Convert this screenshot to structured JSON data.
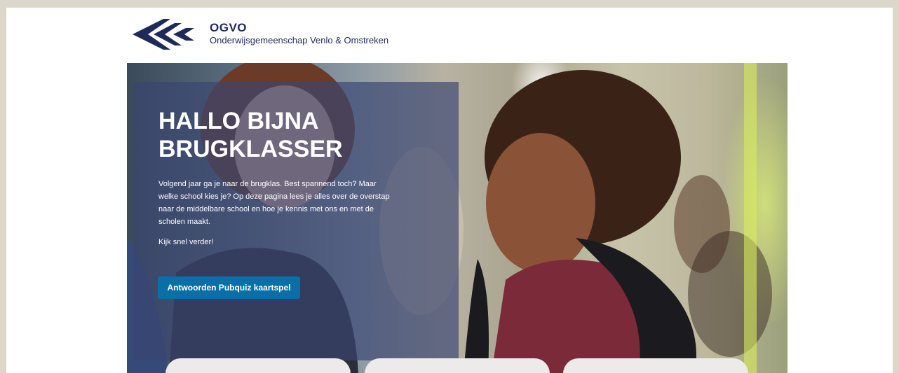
{
  "header": {
    "brand_name": "OGVO",
    "brand_subtitle": "Onderwijsgemeenschap Venlo & Omstreken",
    "logo_icon": "chevron-arrows-logo-icon"
  },
  "hero": {
    "title": "HALLO BIJNA BRUGKLASSER",
    "intro": "Volgend jaar ga je naar de brugklas. Best spannend toch? Maar welke school kies je? Op deze pagina lees je alles over de overstap naar de middelbare school en hoe je kennis met ons en met de scholen maakt.",
    "cta_text": "Kijk snel verder!",
    "button_label": "Antwoorden Pubquiz kaartspel"
  },
  "colors": {
    "brand_navy": "#1e2a5a",
    "overlay": "#3a4570",
    "button": "#0a6fa8",
    "page_border": "#ddd7c9"
  }
}
